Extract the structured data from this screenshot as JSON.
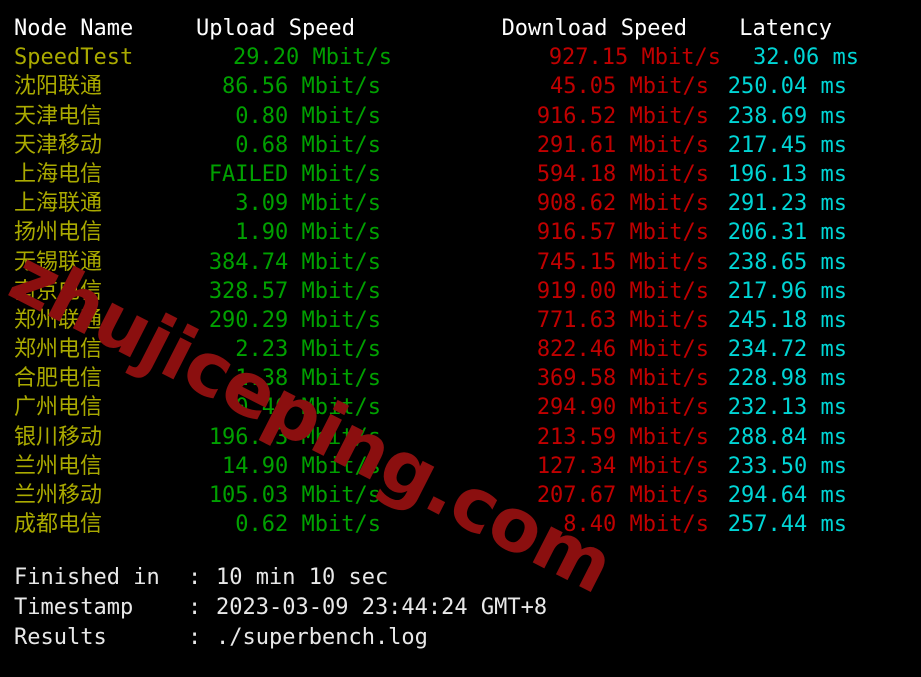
{
  "terminal": {
    "rule": "---------------------------------------------------------------------------------------------------",
    "watermark": "zhujiceping.com"
  },
  "table": {
    "headers": {
      "node": "Node Name",
      "upload": "Upload Speed",
      "download": "Download Speed",
      "latency": "Latency"
    },
    "rows": [
      {
        "node": "SpeedTest",
        "upload": "29.20 Mbit/s",
        "download": "927.15 Mbit/s",
        "latency": "32.06 ms"
      },
      {
        "node": "沈阳联通",
        "upload": "86.56 Mbit/s",
        "download": "45.05 Mbit/s",
        "latency": "250.04 ms"
      },
      {
        "node": "天津电信",
        "upload": "0.80 Mbit/s",
        "download": "916.52 Mbit/s",
        "latency": "238.69 ms"
      },
      {
        "node": "天津移动",
        "upload": "0.68 Mbit/s",
        "download": "291.61 Mbit/s",
        "latency": "217.45 ms"
      },
      {
        "node": "上海电信",
        "upload": "FAILED Mbit/s",
        "download": "594.18 Mbit/s",
        "latency": "196.13 ms"
      },
      {
        "node": "上海联通",
        "upload": "3.09 Mbit/s",
        "download": "908.62 Mbit/s",
        "latency": "291.23 ms"
      },
      {
        "node": "扬州电信",
        "upload": "1.90 Mbit/s",
        "download": "916.57 Mbit/s",
        "latency": "206.31 ms"
      },
      {
        "node": "无锡联通",
        "upload": "384.74 Mbit/s",
        "download": "745.15 Mbit/s",
        "latency": "238.65 ms"
      },
      {
        "node": "南京电信",
        "upload": "328.57 Mbit/s",
        "download": "919.00 Mbit/s",
        "latency": "217.96 ms"
      },
      {
        "node": "郑州联通",
        "upload": "290.29 Mbit/s",
        "download": "771.63 Mbit/s",
        "latency": "245.18 ms"
      },
      {
        "node": "郑州电信",
        "upload": "2.23 Mbit/s",
        "download": "822.46 Mbit/s",
        "latency": "234.72 ms"
      },
      {
        "node": "合肥电信",
        "upload": "1.38 Mbit/s",
        "download": "369.58 Mbit/s",
        "latency": "228.98 ms"
      },
      {
        "node": "广州电信",
        "upload": "0.46 Mbit/s",
        "download": "294.90 Mbit/s",
        "latency": "232.13 ms"
      },
      {
        "node": "银川移动",
        "upload": "196.03 Mbit/s",
        "download": "213.59 Mbit/s",
        "latency": "288.84 ms"
      },
      {
        "node": "兰州电信",
        "upload": "14.90 Mbit/s",
        "download": "127.34 Mbit/s",
        "latency": "233.50 ms"
      },
      {
        "node": "兰州移动",
        "upload": "105.03 Mbit/s",
        "download": "207.67 Mbit/s",
        "latency": "294.64 ms"
      },
      {
        "node": "成都电信",
        "upload": "0.62 Mbit/s",
        "download": "8.40 Mbit/s",
        "latency": "257.44 ms"
      }
    ]
  },
  "footer": {
    "separator": ":",
    "items": [
      {
        "label": "Finished in",
        "value": "10 min 10 sec"
      },
      {
        "label": "Timestamp",
        "value": "2023-03-09 23:44:24 GMT+8"
      },
      {
        "label": "Results",
        "value": "./superbench.log"
      }
    ]
  },
  "colors": {
    "background": "#000000",
    "header_text": "#ffffff",
    "node": "#aaaa00",
    "upload": "#00a000",
    "download": "#c00000",
    "latency": "#00d5d5",
    "footer_text": "#e8e8e8",
    "watermark": "#8b0f0f"
  }
}
